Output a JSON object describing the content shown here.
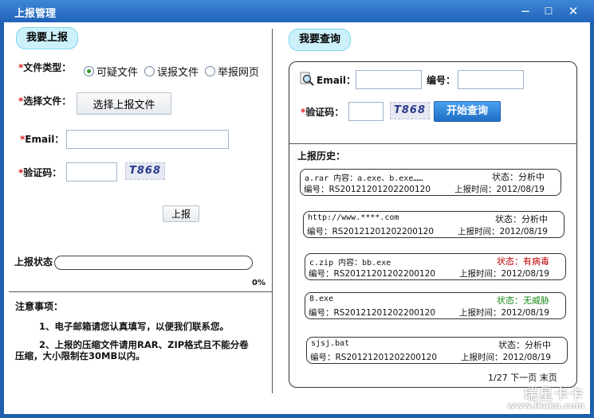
{
  "window": {
    "title": "上报管理",
    "minimize": "−",
    "maximize": "☐",
    "close": "✕"
  },
  "upload": {
    "tab_label": "我要上报",
    "file_type_label": "文件类型：",
    "file_types": [
      "可疑文件",
      "误报文件",
      "举报网页"
    ],
    "selected_file_type": "可疑文件",
    "select_file_label": "选择文件：",
    "select_file_button": "选择上报文件",
    "email_label": "Email：",
    "email_value": "",
    "captcha_label": "验证码：",
    "captcha_value": "",
    "captcha_image_text": "T868",
    "submit_button": "上报",
    "status_label": "上报状态",
    "progress_percent": 0,
    "progress_text": "0%"
  },
  "notes": {
    "title": "注意事项：",
    "items": [
      "1、电子邮箱请您认真填写，以便我们联系您。",
      "2、上报的压缩文件请用RAR、ZIP格式且不能分卷",
      "压缩，大小限制在30MB以内。"
    ]
  },
  "query": {
    "tab_label": "我要查询",
    "email_label": "Email：",
    "email_value": "",
    "id_label": "编号：",
    "id_value": "",
    "captcha_label": "验证码：",
    "captcha_value": "",
    "captcha_image_text": "T868",
    "search_button": "开始查询",
    "history_title": "上报历史：",
    "records": [
      {
        "file": "a.rar 内容：a.exe、b.exe……",
        "status": "状态：分析中",
        "status_color": "#111111",
        "id": "编号：RS20121201202200120",
        "time": "上报时间：2012/08/19"
      },
      {
        "file": "http://www.****.com",
        "status": "状态：分析中",
        "status_color": "#111111",
        "id": "编号：RS20121201202200120",
        "time": "上报时间：2012/08/19"
      },
      {
        "file": "c.zip 内容：bb.exe",
        "status": "状态：有病毒",
        "status_color": "#c00000",
        "id": "编号：RS20121201202200120",
        "time": "上报时间：2012/08/19"
      },
      {
        "file": "8.exe",
        "status": "状态：无威胁",
        "status_color": "#1a8a1a",
        "id": "编号：RS20121201202200120",
        "time": "上报时间：2012/08/19"
      },
      {
        "file": "sjsj.bat",
        "status": "状态：分析中",
        "status_color": "#111111",
        "id": "编号：RS20121201202200120",
        "time": "上报时间：2012/08/19"
      }
    ],
    "pager": {
      "page": "1/27",
      "next": "下一页",
      "last": "末页"
    }
  },
  "watermark": {
    "title": "瑞星卡卡",
    "url": "www.ikaka.com"
  },
  "colors": {
    "accent": "#2063b8",
    "tab_bg": "#cdf1fb",
    "primary_button": "#1f6fc4"
  },
  "icons": {
    "query_icon": "search-icon"
  }
}
